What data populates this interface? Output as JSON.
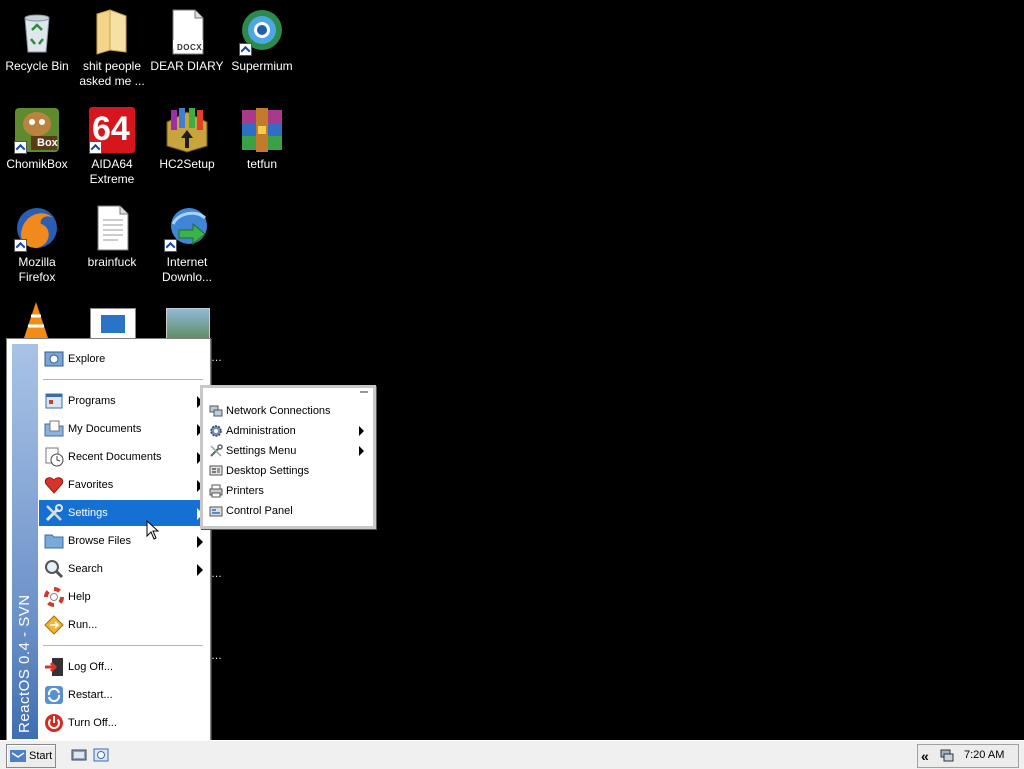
{
  "desktop": {
    "icons": [
      {
        "label": "Recycle Bin",
        "icon": "recycle-bin-icon"
      },
      {
        "label": "shit people asked me ...",
        "icon": "folder-icon"
      },
      {
        "label": "DEAR DIARY",
        "icon": "docx-file-icon"
      },
      {
        "label": "Supermium",
        "icon": "supermium-browser-icon"
      },
      {
        "label": "ChomikBox",
        "icon": "chomikbox-icon"
      },
      {
        "label": "AIDA64 Extreme",
        "icon": "aida64-icon"
      },
      {
        "label": "HC2Setup",
        "icon": "installer-package-icon"
      },
      {
        "label": "tetfun",
        "icon": "winrar-archive-icon"
      },
      {
        "label": "Mozilla Firefox",
        "icon": "firefox-icon"
      },
      {
        "label": "brainfuck",
        "icon": "text-file-icon"
      },
      {
        "label": "Internet Downlo...",
        "icon": "internet-download-manager-icon"
      }
    ],
    "docx_badge": "DOCX",
    "aida_badge": "64",
    "chomik_badge": "Box"
  },
  "start_menu": {
    "banner_text": "ReactOS 0.4 - SVN",
    "items": [
      {
        "label": "Explore",
        "icon": "explore-icon",
        "submenu": false
      },
      {
        "label": "Programs",
        "icon": "programs-icon",
        "submenu": true
      },
      {
        "label": "My Documents",
        "icon": "my-documents-icon",
        "submenu": true
      },
      {
        "label": "Recent Documents",
        "icon": "recent-documents-icon",
        "submenu": true
      },
      {
        "label": "Favorites",
        "icon": "favorites-heart-icon",
        "submenu": true
      },
      {
        "label": "Settings",
        "icon": "settings-tools-icon",
        "submenu": true,
        "highlighted": true
      },
      {
        "label": "Browse Files",
        "icon": "browse-files-folder-icon",
        "submenu": true
      },
      {
        "label": "Search",
        "icon": "search-magnifier-icon",
        "submenu": true
      },
      {
        "label": "Help",
        "icon": "help-lifebuoy-icon",
        "submenu": false
      },
      {
        "label": "Run...",
        "icon": "run-icon",
        "submenu": false
      },
      {
        "label": "Log Off...",
        "icon": "log-off-icon",
        "submenu": false
      },
      {
        "label": "Restart...",
        "icon": "restart-icon",
        "submenu": false
      },
      {
        "label": "Turn Off...",
        "icon": "turn-off-icon",
        "submenu": false
      }
    ]
  },
  "settings_submenu": {
    "items": [
      {
        "label": "Network Connections",
        "icon": "network-connections-icon",
        "submenu": false
      },
      {
        "label": "Administration",
        "icon": "administration-gear-icon",
        "submenu": true
      },
      {
        "label": "Settings Menu",
        "icon": "settings-menu-icon",
        "submenu": true
      },
      {
        "label": "Desktop Settings",
        "icon": "desktop-settings-icon",
        "submenu": false
      },
      {
        "label": "Printers",
        "icon": "printer-icon",
        "submenu": false
      },
      {
        "label": "Control Panel",
        "icon": "control-panel-icon",
        "submenu": false
      }
    ]
  },
  "taskbar": {
    "start_label": "Start",
    "expand_glyph": "«",
    "clock": "7:20 AM"
  },
  "colors": {
    "desktop_bg": "#000000",
    "menu_highlight": "#1470d2",
    "banner_top": "#a9c3e6",
    "banner_bottom": "#3f6fb0"
  }
}
